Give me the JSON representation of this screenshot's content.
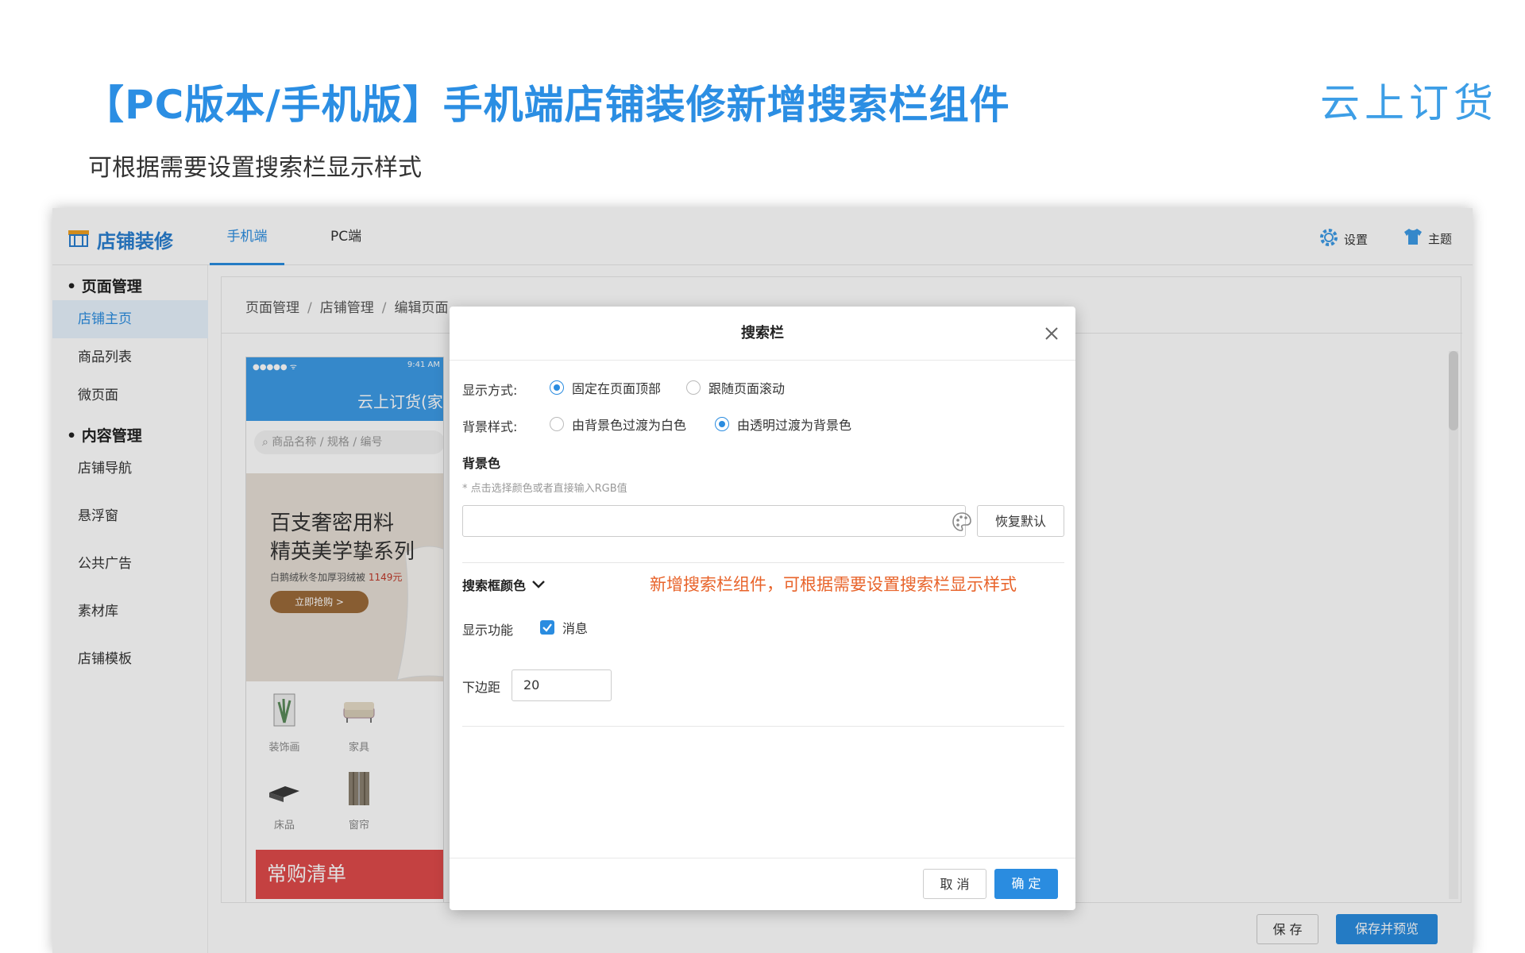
{
  "slide": {
    "title": "【PC版本/手机版】手机端店铺装修新增搜索栏组件",
    "subtitle": "可根据需要设置搜索栏显示样式",
    "logo": "云上订货"
  },
  "app": {
    "title": "店铺装修",
    "tabs": [
      "手机端",
      "PC端"
    ],
    "actions": {
      "settings": "设置",
      "theme": "主题"
    }
  },
  "sidebar": {
    "group1": "页面管理",
    "group1_items": [
      "店铺主页",
      "商品列表",
      "微页面"
    ],
    "group2": "内容管理",
    "group2_items": [
      "店铺导航",
      "悬浮窗",
      "公共广告",
      "素材库",
      "店铺模板"
    ]
  },
  "breadcrumb": [
    "页面管理",
    "店铺管理",
    "编辑页面"
  ],
  "phone": {
    "status_left": "●●●●● ᯤ",
    "time": "9:41 AM",
    "store_name": "云上订货(家",
    "search_placeholder": "商品名称 / 规格 / 编号",
    "banner_line1": "百支奢密用料",
    "banner_line2": "精英美学挚系列",
    "banner_sub": "白鹅绒秋冬加厚羽绒被",
    "banner_price": "1149元",
    "banner_button": "立即抢购 >",
    "categories": [
      "装饰画",
      "家具",
      "床品",
      "窗帘"
    ],
    "wishlist": "常购清单"
  },
  "footer_buttons": {
    "save": "保 存",
    "save_preview": "保存并预览"
  },
  "modal": {
    "title": "搜索栏",
    "display_mode_label": "显示方式:",
    "display_mode_options": [
      "固定在页面顶部",
      "跟随页面滚动"
    ],
    "display_mode_selected": "固定在页面顶部",
    "bg_style_label": "背景样式:",
    "bg_style_options": [
      "由背景色过渡为白色",
      "由透明过渡为背景色"
    ],
    "bg_style_selected": "由透明过渡为背景色",
    "bg_color_title": "背景色",
    "bg_color_hint": "* 点击选择颜色或者直接输入RGB值",
    "bg_color_value": "",
    "reset_button": "恢复默认",
    "search_box_color": "搜索框颜色",
    "annotation": "新增搜索栏组件，可根据需要设置搜索栏显示样式",
    "show_features_label": "显示功能",
    "show_features_option": "消息",
    "show_features_checked": true,
    "bottom_margin_label": "下边距",
    "bottom_margin_value": "20",
    "cancel": "取 消",
    "ok": "确 定"
  },
  "colors": {
    "brand": "#2a8ce0",
    "title": "#2b8ee3",
    "annotation": "#e8632a",
    "wishlist": "#e04a4a"
  }
}
